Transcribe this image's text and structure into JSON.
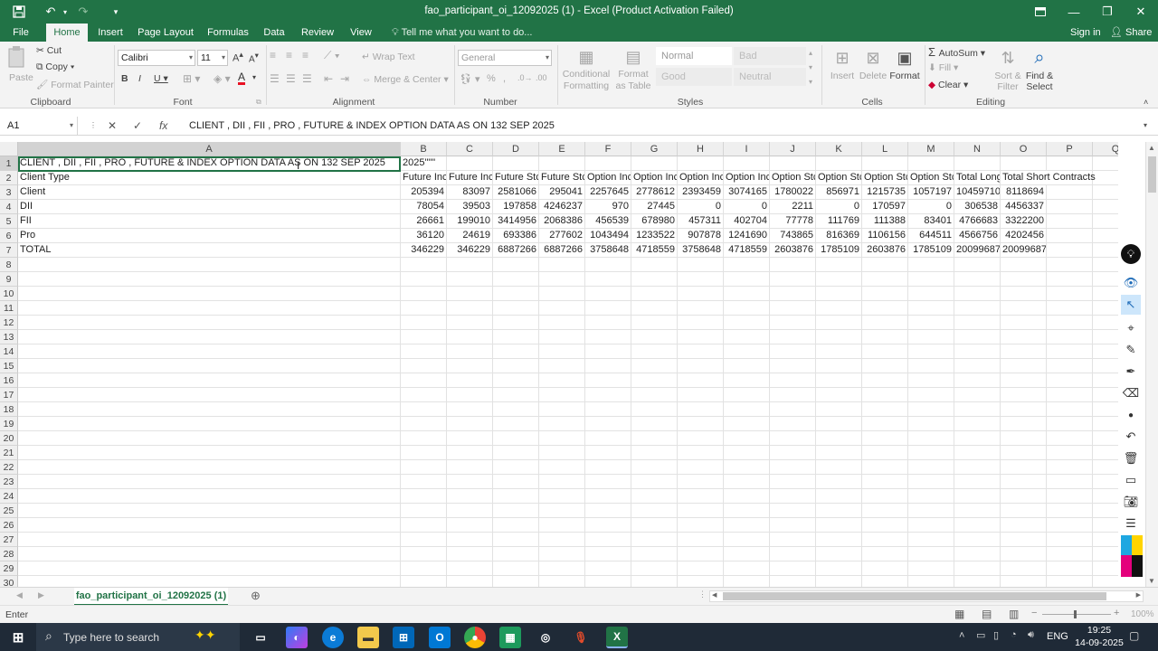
{
  "titlebar": {
    "title": "fao_participant_oi_12092025 (1) - Excel (Product Activation Failed)",
    "save_icon": "save-icon",
    "undo_icon": "undo-icon",
    "redo_icon": "redo-icon",
    "customize_icon": "customize-qat-icon"
  },
  "tabs": [
    "File",
    "Home",
    "Insert",
    "Page Layout",
    "Formulas",
    "Data",
    "Review",
    "View"
  ],
  "active_tab": "Home",
  "tell_me": "Tell me what you want to do...",
  "sign_in": "Sign in",
  "share": "Share",
  "ribbon": {
    "clipboard": {
      "paste": "Paste",
      "cut": "Cut",
      "copy": "Copy",
      "format_painter": "Format Painter",
      "label": "Clipboard"
    },
    "font": {
      "name": "Calibri",
      "size": "11",
      "label": "Font"
    },
    "alignment": {
      "wrap": "Wrap Text",
      "merge": "Merge & Center",
      "label": "Alignment"
    },
    "number": {
      "format": "General",
      "label": "Number"
    },
    "styles": {
      "conditional": "Conditional Formatting",
      "format_as_table": "Format as Table",
      "normal": "Normal",
      "bad": "Bad",
      "good": "Good",
      "neutral": "Neutral",
      "label": "Styles"
    },
    "cells": {
      "insert": "Insert",
      "delete": "Delete",
      "format": "Format",
      "label": "Cells"
    },
    "editing": {
      "autosum": "AutoSum",
      "fill": "Fill",
      "clear": "Clear",
      "sort": "Sort & Filter",
      "find": "Find & Select",
      "label": "Editing"
    }
  },
  "formula_bar": {
    "name_box": "A1",
    "cancel": "✕",
    "enter": "✓",
    "fx": "fx",
    "formula": "CLIENT , DII , FII , PRO , FUTURE & INDEX OPTION DATA AS ON 132 SEP 2025"
  },
  "columns": [
    "A",
    "B",
    "C",
    "D",
    "E",
    "F",
    "G",
    "H",
    "I",
    "J",
    "K",
    "L",
    "M",
    "N",
    "O",
    "P",
    "Q"
  ],
  "row_numbers": [
    "1",
    "2",
    "3",
    "4",
    "5",
    "6",
    "7",
    "8",
    "9",
    "10",
    "11",
    "12",
    "13",
    "14",
    "15",
    "16",
    "17",
    "18",
    "19",
    "20",
    "21",
    "22",
    "23",
    "24",
    "25",
    "26",
    "27",
    "28",
    "29",
    "30"
  ],
  "row1": {
    "a": "CLIENT , DII , FII , PRO , FUTURE & INDEX OPTION DATA AS ON 132 SEP 2025",
    "b": "2025\"\"\""
  },
  "headers": [
    "Client Type",
    "Future Inc",
    "Future Inc",
    "Future Stc",
    "Future Stc",
    "Option Inc",
    "Option Inc",
    "Option Inc",
    "Option Inc",
    "Option Stc",
    "Option Stc",
    "Option Stc",
    "Option Stc",
    "Total Long",
    "Total Short Contracts"
  ],
  "rows": [
    [
      "Client",
      "205394",
      "83097",
      "2581066",
      "295041",
      "2257645",
      "2778612",
      "2393459",
      "3074165",
      "1780022",
      "856971",
      "1215735",
      "1057197",
      "10459710",
      "8118694"
    ],
    [
      "DII",
      "78054",
      "39503",
      "197858",
      "4246237",
      "970",
      "27445",
      "0",
      "0",
      "2211",
      "0",
      "170597",
      "0",
      "306538",
      "4456337"
    ],
    [
      "FII",
      "26661",
      "199010",
      "3414956",
      "2068386",
      "456539",
      "678980",
      "457311",
      "402704",
      "77778",
      "111769",
      "111388",
      "83401",
      "4766683",
      "3322200"
    ],
    [
      "Pro",
      "36120",
      "24619",
      "693386",
      "277602",
      "1043494",
      "1233522",
      "907878",
      "1241690",
      "743865",
      "816369",
      "1106156",
      "644511",
      "4566756",
      "4202456"
    ],
    [
      "TOTAL",
      "346229",
      "346229",
      "6887266",
      "6887266",
      "3758648",
      "4718559",
      "3758648",
      "4718559",
      "2603876",
      "1785109",
      "2603876",
      "1785109",
      "20099687",
      "20099687"
    ]
  ],
  "sheet_tab": "fao_participant_oi_12092025 (1)",
  "status": {
    "mode": "Enter",
    "zoom": "100%"
  },
  "taskbar": {
    "search": "Type here to search",
    "language": "ENG",
    "time": "19:25",
    "date": "14-09-2025"
  },
  "colors": {
    "excel_green": "#217346",
    "taskbar": "#1f2a37"
  }
}
